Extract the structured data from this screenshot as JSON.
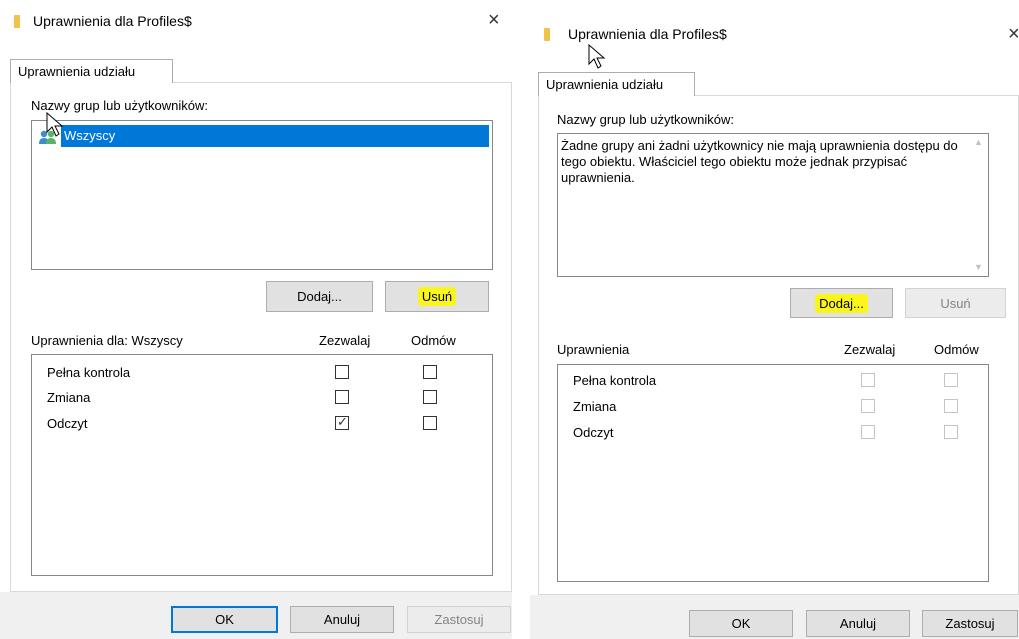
{
  "left": {
    "title": "Uprawnienia dla Profiles$",
    "close_glyph": "×",
    "tab_label": "Uprawnienia udziału",
    "groups_label": "Nazwy grup lub użytkowników:",
    "groups": [
      {
        "name": "Wszyscy",
        "selected": true
      }
    ],
    "add_button": "Dodaj...",
    "remove_button": "Usuń",
    "perm_header": "Uprawnienia dla: Wszyscy",
    "allow_header": "Zezwalaj",
    "deny_header": "Odmów",
    "permissions": [
      {
        "name": "Pełna kontrola",
        "allow": false,
        "deny": false
      },
      {
        "name": "Zmiana",
        "allow": false,
        "deny": false
      },
      {
        "name": "Odczyt",
        "allow": true,
        "deny": false
      }
    ],
    "ok_button": "OK",
    "cancel_button": "Anuluj",
    "apply_button": "Zastosuj"
  },
  "right": {
    "title": "Uprawnienia dla Profiles$",
    "close_glyph": "×",
    "tab_label": "Uprawnienia udziału",
    "groups_label": "Nazwy grup lub użytkowników:",
    "empty_message": "Żadne grupy ani żadni użytkownicy nie mają uprawnienia dostępu do tego obiektu. Właściciel tego obiektu może jednak przypisać uprawnienia.",
    "add_button": "Dodaj...",
    "remove_button": "Usuń",
    "perm_header": "Uprawnienia",
    "allow_header": "Zezwalaj",
    "deny_header": "Odmów",
    "permissions": [
      {
        "name": "Pełna kontrola"
      },
      {
        "name": "Zmiana"
      },
      {
        "name": "Odczyt"
      }
    ],
    "ok_button": "OK",
    "cancel_button": "Anuluj",
    "apply_button": "Zastosuj"
  },
  "colors": {
    "selection": "#0078d7",
    "highlight": "#fbf51e",
    "folder": "#f0c24a"
  }
}
